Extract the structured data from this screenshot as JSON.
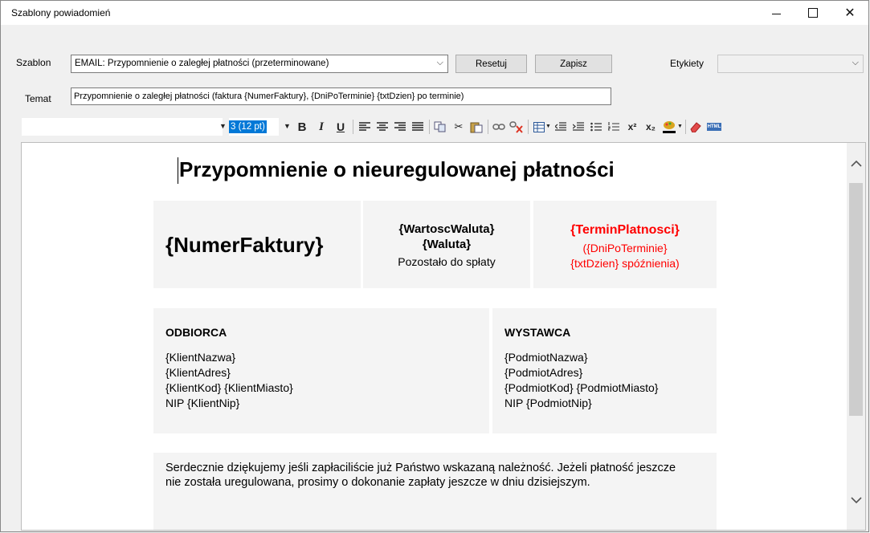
{
  "window": {
    "title": "Szablony powiadomień"
  },
  "form": {
    "szablon_label": "Szablon",
    "szablon_value": "EMAIL: Przypomnienie o zaległej płatności (przeterminowane)",
    "reset_label": "Resetuj",
    "save_label": "Zapisz",
    "etykiety_label": "Etykiety",
    "etykiety_value": "",
    "temat_label": "Temat",
    "temat_value": "Przypomnienie o zaległej płatności (faktura {NumerFaktury}, {DniPoTerminie} {txtDzien} po terminie)"
  },
  "toolbar": {
    "font_value": "",
    "size_value": "3 (12 pt)",
    "bold": "B",
    "italic": "I",
    "underline": "U",
    "superscript": "x²",
    "subscript": "x₂",
    "html": "HTML"
  },
  "document": {
    "title": "Przypomnienie o nieuregulowanej płatności",
    "invoice_number": "{NumerFaktury}",
    "amount_line1": "{WartoscWaluta}",
    "amount_line2": "{Waluta}",
    "amount_caption": "Pozostało do spłaty",
    "due_date": "{TerminPlatnosci}",
    "overdue_line1": "({DniPoTerminie}",
    "overdue_line2": "{txtDzien} spóźnienia)",
    "recipient": {
      "heading": "ODBIORCA",
      "name": "{KlientNazwa}",
      "address": "{KlientAdres}",
      "city": "{KlientKod} {KlientMiasto}",
      "nip": "NIP {KlientNip}"
    },
    "issuer": {
      "heading": "WYSTAWCA",
      "name": "{PodmiotNazwa}",
      "address": "{PodmiotAdres}",
      "city": "{PodmiotKod} {PodmiotMiasto}",
      "nip": "NIP {PodmiotNip}"
    },
    "thanks_paragraph": "Serdecznie dziękujemy jeśli zapłaciliście już Państwo wskazaną należność. Jeżeli płatność jeszcze nie została uregulowana, prosimy o dokonanie zapłaty jeszcze w dniu dzisiejszym."
  },
  "colors": {
    "overdue": "#ff0000",
    "selection": "#0078d7"
  }
}
